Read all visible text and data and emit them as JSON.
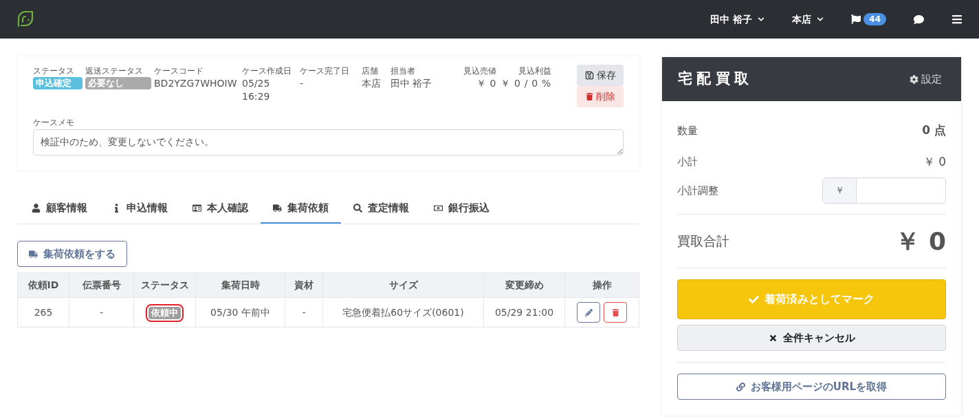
{
  "header": {
    "user": "田中 裕子",
    "store": "本店",
    "flag_count": "44"
  },
  "case": {
    "fields": [
      {
        "label": "ステータス",
        "kind": "badge",
        "value": "申込確定",
        "color": "#5bc0de"
      },
      {
        "label": "返送ステータス",
        "kind": "badge",
        "value": "必要なし",
        "color": "#aaaaaa"
      },
      {
        "label": "ケースコード",
        "kind": "text",
        "value": "BD2YZG7WHOIW"
      },
      {
        "label": "ケース作成日",
        "kind": "text",
        "value": "05/25 16:29"
      },
      {
        "label": "ケース完了日",
        "kind": "text",
        "value": "-"
      },
      {
        "label": "店舗",
        "kind": "text",
        "value": "本店"
      },
      {
        "label": "担当者",
        "kind": "text",
        "value": "田中 裕子"
      },
      {
        "label": "見込売値",
        "kind": "amount",
        "value": "￥ 0"
      },
      {
        "label": "見込利益",
        "kind": "amount",
        "value": "￥ 0 / 0 %"
      }
    ],
    "save": "保存",
    "delete": "削除",
    "memo_label": "ケースメモ",
    "memo": "検証中のため、変更しないでください。"
  },
  "tabs": [
    {
      "label": "顧客情報",
      "selected": false
    },
    {
      "label": "申込情報",
      "selected": false
    },
    {
      "label": "本人確認",
      "selected": false
    },
    {
      "label": "集荷依頼",
      "selected": true
    },
    {
      "label": "査定情報",
      "selected": false
    },
    {
      "label": "銀行振込",
      "selected": false
    }
  ],
  "request_button": "集荷依頼をする",
  "table": {
    "columns": [
      "依頼ID",
      "伝票番号",
      "ステータス",
      "集荷日時",
      "資材",
      "サイズ",
      "変更締め",
      "操作"
    ],
    "rows": [
      {
        "id": "265",
        "slip": "-",
        "status": "依頼中",
        "highlighted": true,
        "pickup": "05/30 午前中",
        "material": "-",
        "size": "宅急便着払60サイズ(0601)",
        "deadline": "05/29 21:00"
      }
    ]
  },
  "panel": {
    "title": "宅配買取",
    "settings": "設定",
    "quantity_label": "数量",
    "quantity": "0 点",
    "subtotal_label": "小計",
    "subtotal": "￥ 0",
    "adjust_label": "小計調整",
    "adjust_prefix": "￥",
    "total_label": "買取合計",
    "total": "￥ 0",
    "mark_button": "着荷済みとしてマーク",
    "cancel_button": "全件キャンセル",
    "url_button": "お客様用ページのURLを取得"
  }
}
